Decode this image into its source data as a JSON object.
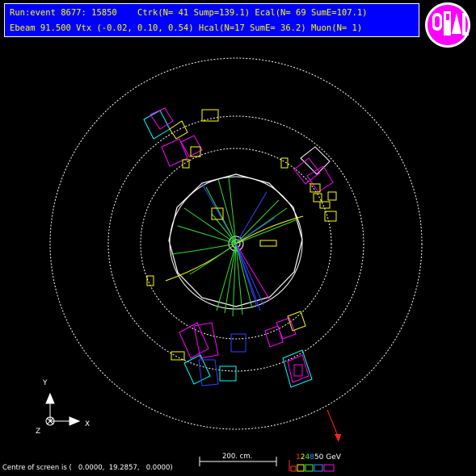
{
  "header": {
    "line1": "Run:event 8677: 15850    Ctrk(N= 41 Sump=139.1) Ecal(N= 69 SumE=107.1)",
    "line2": "Ebeam 91.500 Vtx (-0.02, 0.10, 0.54) Hcal(N=17 SumE= 36.2) Muon(N= 1)",
    "bg_color": "#0000ff",
    "text_color": "#ffff00"
  },
  "logo": {
    "icon": "opal-logo-icon",
    "color": "#ff00ff"
  },
  "axes": {
    "y": "Y",
    "z": "Z",
    "x": "X"
  },
  "scale": {
    "label": "200. cm."
  },
  "energy_legend": {
    "labels": [
      {
        "text": "1",
        "color": "#ff3333"
      },
      {
        "text": "2",
        "color": "#ffff00"
      },
      {
        "text": "4",
        "color": "#33ff33"
      },
      {
        "text": "8",
        "color": "#4488ff"
      },
      {
        "text": "50 GeV",
        "color": "#ffffff"
      }
    ]
  },
  "footer": {
    "coords": "Centre of screen is (   0.0000,  19.2857,   0.0000)"
  },
  "colors": {
    "track_green": "#33dd33",
    "track_blue": "#3344ff",
    "ecal_magenta": "#ff00ff",
    "hcal_cyan": "#00ffff",
    "yellow": "#ffff00",
    "missing_energy_red": "#ff2222"
  }
}
